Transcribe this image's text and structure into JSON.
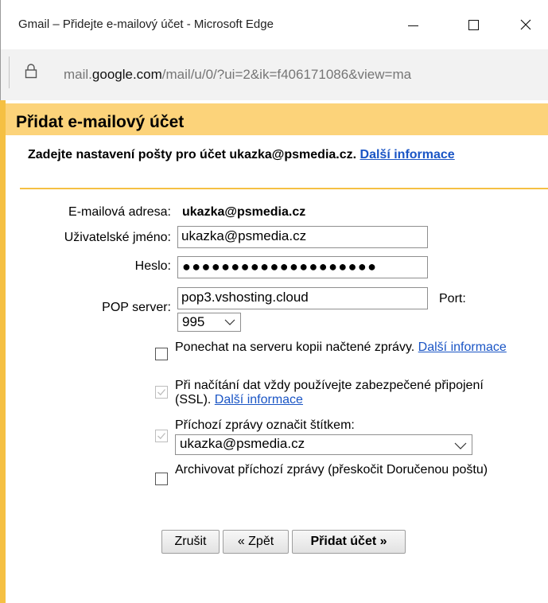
{
  "window": {
    "title": "Gmail – Přidejte e-mailový účet - Microsoft Edge",
    "controls": [
      "minimize-icon",
      "maximize-icon",
      "close-icon"
    ]
  },
  "address_bar": {
    "url_prefix": "mail.",
    "url_host": "google.com",
    "url_rest": "/mail/u/0/?ui=2&ik=f406171086&view=ma",
    "icon": "lock-icon"
  },
  "dialog": {
    "title": "Přidat e-mailový účet",
    "intro_text": "Zadejte nastavení pošty pro účet ukazka@psmedia.cz.",
    "intro_link": "Další informace",
    "fields": {
      "email_label": "E-mailová adresa:",
      "email_value": "ukazka@psmedia.cz",
      "username_label": "Uživatelské jméno:",
      "username_value": "ukazka@psmedia.cz",
      "password_label": "Heslo:",
      "password_value": "●●●●●●●●●●●●●●●●●●●●",
      "pop_label": "POP server:",
      "pop_value": "pop3.vshosting.cloud",
      "port_label": "Port:",
      "port_value": "995"
    },
    "options": {
      "keep_copy_text": "Ponechat na serveru kopii načtené zprávy.",
      "keep_copy_link": "Další informace",
      "keep_copy_checked": false,
      "ssl_text": "Při načítání dat vždy používejte zabezpečené připojení (SSL).",
      "ssl_link": "Další informace",
      "ssl_checked": true,
      "label_text": "Příchozí zprávy označit štítkem:",
      "label_checked": true,
      "label_value": "ukazka@psmedia.cz",
      "archive_text": "Archivovat příchozí zprávy (přeskočit Doručenou poštu)",
      "archive_checked": false
    },
    "buttons": {
      "cancel": "Zrušit",
      "back": "« Zpět",
      "add": "Přidat účet »"
    },
    "colors": {
      "header_bg": "#fcd37a",
      "accent": "#f5c043",
      "link": "#1a55c5"
    }
  }
}
